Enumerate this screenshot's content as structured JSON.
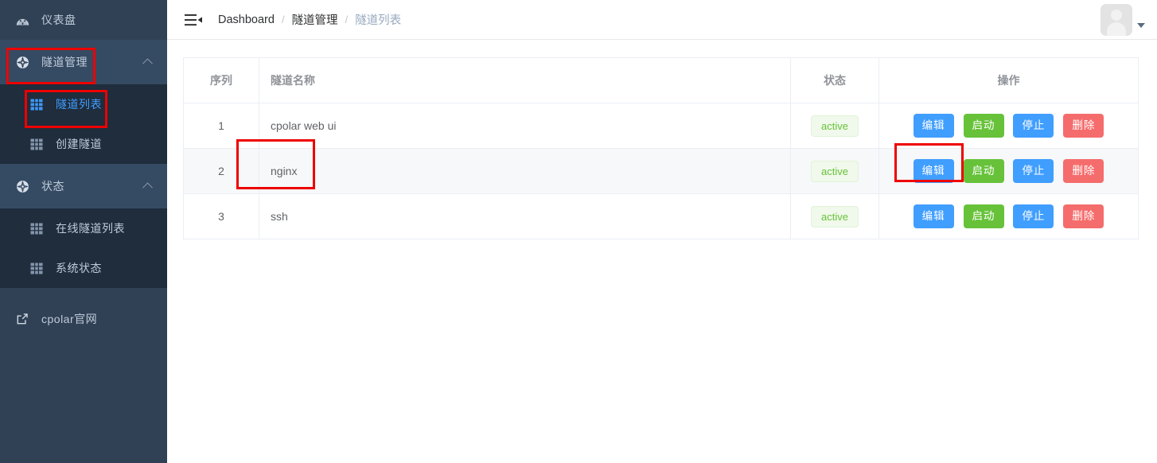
{
  "sidebar": {
    "items": [
      {
        "label": "仪表盘",
        "icon": "dashboard-icon",
        "type": "link"
      },
      {
        "label": "隧道管理",
        "icon": "compass-icon",
        "type": "group",
        "expanded": true
      },
      {
        "label": "隧道列表",
        "icon": "table-grid-icon",
        "type": "sub",
        "active": true
      },
      {
        "label": "创建隧道",
        "icon": "table-grid-icon",
        "type": "sub",
        "active": false
      },
      {
        "label": "状态",
        "icon": "compass-icon",
        "type": "group",
        "expanded": true
      },
      {
        "label": "在线隧道列表",
        "icon": "table-grid-icon",
        "type": "sub",
        "active": false
      },
      {
        "label": "系统状态",
        "icon": "table-grid-icon",
        "type": "sub",
        "active": false
      },
      {
        "label": "cpolar官网",
        "icon": "external-link-icon",
        "type": "link"
      }
    ],
    "bg_color": "#304156",
    "active_color": "#409eff"
  },
  "topbar": {
    "hamburger_icon": "hamburger-collapse-icon",
    "breadcrumb": [
      {
        "label": "Dashboard",
        "muted": false
      },
      {
        "label": "隧道管理",
        "muted": false
      },
      {
        "label": "隧道列表",
        "muted": true
      }
    ],
    "separator": "/",
    "avatar_icon": "user-avatar-placeholder",
    "avatar_caret_icon": "caret-down-icon"
  },
  "table": {
    "headers": {
      "seq": "序列",
      "name": "隧道名称",
      "state": "状态",
      "ops": "操作"
    },
    "rows": [
      {
        "seq": "1",
        "name": "cpolar web ui",
        "state": "active",
        "actions": [
          "编辑",
          "启动",
          "停止",
          "删除"
        ]
      },
      {
        "seq": "2",
        "name": "nginx",
        "state": "active",
        "actions": [
          "编辑",
          "启动",
          "停止",
          "删除"
        ]
      },
      {
        "seq": "3",
        "name": "ssh",
        "state": "active",
        "actions": [
          "编辑",
          "启动",
          "停止",
          "删除"
        ]
      }
    ],
    "button_colors": {
      "edit": "#409eff",
      "start": "#67c23a",
      "stop": "#409eff",
      "delete": "#f56c6c"
    },
    "badge_colors": {
      "text": "#67c23a",
      "bg": "#f0f9eb",
      "border": "#e1f3d8"
    }
  },
  "annotations": {
    "color": "#ee0000",
    "boxes": [
      {
        "name": "menu-group-highlight"
      },
      {
        "name": "menu-item-highlight"
      },
      {
        "name": "tunnel-name-cell-highlight"
      },
      {
        "name": "edit-button-highlight"
      }
    ]
  }
}
